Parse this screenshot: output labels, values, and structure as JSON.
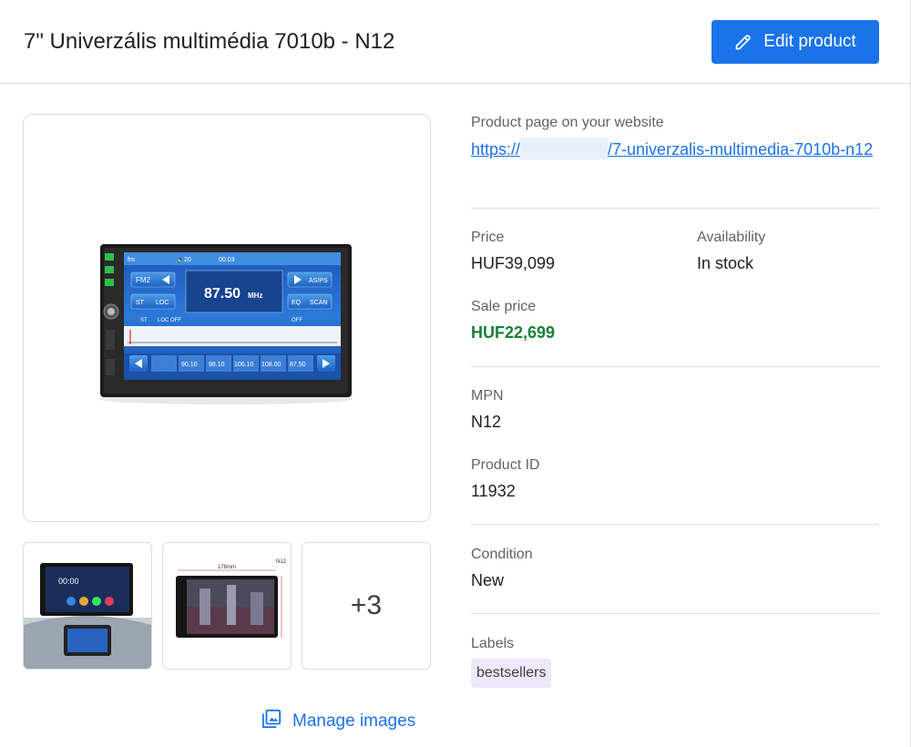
{
  "header": {
    "title": "7\" Univerzális multimédia 7010b - N12",
    "edit_button_label": "Edit product"
  },
  "images": {
    "main_alt": "7010b car multimedia unit",
    "more_count_label": "+3",
    "manage_images_label": "Manage images"
  },
  "details": {
    "product_page_label": "Product page on your website",
    "product_page_url_prefix": "https://",
    "product_page_url_suffix": "/7-univerzalis-multimedia-7010b-n12",
    "price_label": "Price",
    "price_value": "HUF39,099",
    "availability_label": "Availability",
    "availability_value": "In stock",
    "sale_price_label": "Sale price",
    "sale_price_value": "HUF22,699",
    "mpn_label": "MPN",
    "mpn_value": "N12",
    "product_id_label": "Product ID",
    "product_id_value": "11932",
    "condition_label": "Condition",
    "condition_value": "New",
    "labels_label": "Labels",
    "labels": [
      "bestsellers"
    ]
  },
  "device_screen": {
    "band": "FM2",
    "frequency": "87.50",
    "unit": "MHz",
    "volume": "20",
    "clock": "00:03",
    "presets": [
      "90.10",
      "98.10",
      "106.10",
      "108.00",
      "87.50"
    ]
  },
  "thumb_1": {
    "clock": "00:00"
  },
  "thumb_2": {
    "dimension": "178mm",
    "badge": "N12"
  },
  "colors": {
    "accent": "#1a73e8",
    "sale": "#188038",
    "label_badge": "#efe7fb",
    "divider": "#e0e0e0"
  }
}
